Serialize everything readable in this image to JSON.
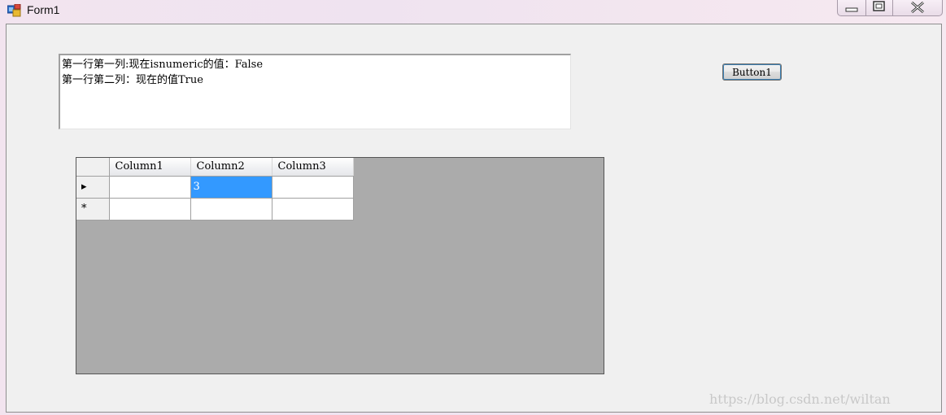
{
  "window": {
    "title": "Form1",
    "icon": "winforms-app-icon",
    "caption_buttons": [
      "minimize-icon",
      "maximize-icon",
      "close-icon"
    ]
  },
  "textbox": {
    "lines": [
      "第一行第一列:现在isnumeric的值：False",
      "第一行第二列：现在的值True"
    ]
  },
  "button1": {
    "label": "Button1"
  },
  "grid": {
    "columns": [
      "Column1",
      "Column2",
      "Column3"
    ],
    "rows": [
      {
        "indicator": "▸",
        "cells": [
          "",
          "3",
          ""
        ]
      },
      {
        "indicator": "*",
        "cells": [
          "",
          "",
          ""
        ]
      }
    ],
    "selected_color": "#3399ff",
    "background_color": "#ababab"
  },
  "watermark": "https://blog.csdn.net/wiltan"
}
